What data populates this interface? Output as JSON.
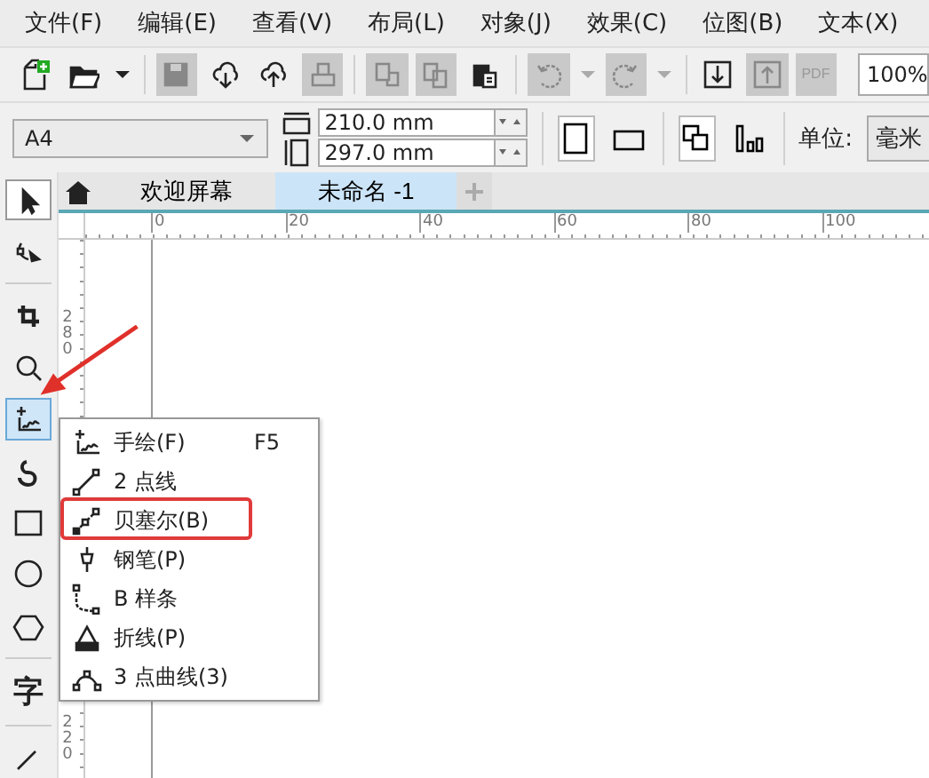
{
  "menu_bar": [
    "文件(F)",
    "编辑(E)",
    "查看(V)",
    "布局(L)",
    "对象(J)",
    "效果(C)",
    "位图(B)",
    "文本(X)"
  ],
  "toolbar": [
    {
      "kind": "new",
      "disabled": false
    },
    {
      "kind": "open",
      "disabled": false
    },
    {
      "kind": "caret",
      "disabled": false
    },
    {
      "kind": "sep"
    },
    {
      "kind": "save",
      "disabled": true
    },
    {
      "kind": "download",
      "disabled": false
    },
    {
      "kind": "upload",
      "disabled": false
    },
    {
      "kind": "print",
      "disabled": true
    },
    {
      "kind": "sep"
    },
    {
      "kind": "copy",
      "disabled": true
    },
    {
      "kind": "paste",
      "disabled": true
    },
    {
      "kind": "clip",
      "disabled": false
    },
    {
      "kind": "sep"
    },
    {
      "kind": "undo",
      "disabled": true
    },
    {
      "kind": "caret",
      "disabled": true
    },
    {
      "kind": "redo",
      "disabled": true
    },
    {
      "kind": "caret",
      "disabled": true
    },
    {
      "kind": "sep"
    },
    {
      "kind": "import",
      "disabled": false
    },
    {
      "kind": "export",
      "disabled": true
    },
    {
      "kind": "pdf",
      "disabled": true,
      "label": "PDF"
    }
  ],
  "zoom": {
    "value": "100%"
  },
  "property_bar": {
    "page_size": "A4",
    "width": "210.0 mm",
    "height": "297.0 mm",
    "orientation_buttons": [
      {
        "kind": "portrait",
        "selected": true
      },
      {
        "kind": "landscape",
        "selected": false
      }
    ],
    "units_label": "单位:",
    "units": "毫米"
  },
  "toolbox": [
    {
      "kind": "pick",
      "selected": true
    },
    {
      "kind": "shape",
      "selected": false
    },
    {
      "kind": "sep"
    },
    {
      "kind": "crop",
      "selected": false
    },
    {
      "kind": "zoom",
      "selected": false
    },
    {
      "kind": "freehand",
      "selected": true
    },
    {
      "kind": "artistic",
      "selected": false
    },
    {
      "kind": "rect",
      "selected": false
    },
    {
      "kind": "ellipse",
      "selected": false
    },
    {
      "kind": "polygon",
      "selected": false
    },
    {
      "kind": "sep"
    },
    {
      "kind": "text",
      "selected": false,
      "label": "字"
    },
    {
      "kind": "sep"
    },
    {
      "kind": "line",
      "selected": false
    }
  ],
  "tabs": [
    {
      "label": "欢迎屏幕",
      "selected": false
    },
    {
      "label": "未命名 -1",
      "selected": true
    }
  ],
  "ruler": {
    "horizontal": [
      "0",
      "20",
      "40",
      "60",
      "80",
      "100"
    ],
    "vertical": [
      "280",
      "220"
    ]
  },
  "flyout_menu": [
    {
      "kind": "freehand",
      "label": "手绘(F)",
      "shortcut": "F5",
      "highlighted": false
    },
    {
      "kind": "twopoint",
      "label": "2 点线",
      "highlighted": false
    },
    {
      "kind": "bezier",
      "label": "贝塞尔(B)",
      "highlighted": true
    },
    {
      "kind": "pen",
      "label": "钢笔(P)",
      "highlighted": false
    },
    {
      "kind": "bspline",
      "label": "B 样条",
      "highlighted": false
    },
    {
      "kind": "polyline",
      "label": "折线(P)",
      "highlighted": false
    },
    {
      "kind": "threepoint",
      "label": "3 点曲线(3)",
      "highlighted": false
    }
  ]
}
